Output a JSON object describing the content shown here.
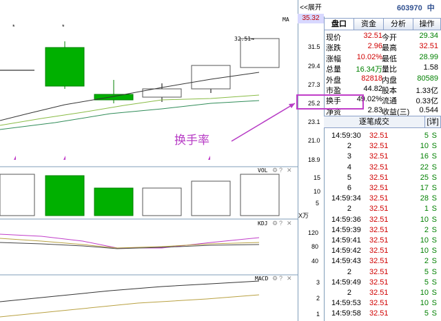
{
  "header": {
    "expand_label": "<<展开",
    "top_price": "35.32",
    "stock_code": "603970",
    "stock_name": "中农"
  },
  "tabs": [
    {
      "label": "盘口",
      "active": true
    },
    {
      "label": "资金",
      "active": false
    },
    {
      "label": "分析",
      "active": false
    },
    {
      "label": "操作",
      "active": false
    }
  ],
  "quote": {
    "rows": [
      {
        "l_label": "现价",
        "l_value": "32.51",
        "l_color": "red",
        "r_label": "今开",
        "r_value": "29.34",
        "r_color": "green"
      },
      {
        "l_label": "涨跌",
        "l_value": "2.96",
        "l_color": "red",
        "r_label": "最高",
        "r_value": "32.51",
        "r_color": "red"
      },
      {
        "l_label": "涨幅",
        "l_value": "10.02%",
        "l_color": "red",
        "r_label": "最低",
        "r_value": "28.99",
        "r_color": "green"
      },
      {
        "l_label": "总量",
        "l_value": "16.34万",
        "l_color": "green",
        "r_label": "量比",
        "r_value": "1.58",
        "r_color": "blk"
      },
      {
        "l_label": "外盘",
        "l_value": "82818",
        "l_color": "red",
        "r_label": "内盘",
        "r_value": "80589",
        "r_color": "green"
      },
      {
        "l_label": "市盈",
        "l_value": "44.82",
        "l_color": "blk",
        "r_label": "股本",
        "r_value": "1.33亿",
        "r_color": "blk"
      },
      {
        "l_label": "换手",
        "l_value": "49.02%",
        "l_color": "blk",
        "r_label": "流通",
        "r_value": "0.33亿",
        "r_color": "blk"
      },
      {
        "l_label": "净资",
        "l_value": "2.83",
        "l_color": "blk",
        "r_label": "收益(三)",
        "r_value": "0.544",
        "r_color": "blk"
      }
    ]
  },
  "trades_section": {
    "title": "逐笔成交",
    "detail_label": "[详]",
    "rows": [
      {
        "time": "14:59:30",
        "price": "32.51",
        "vol": "5",
        "side": "S"
      },
      {
        "time": "2",
        "price": "32.51",
        "vol": "10",
        "side": "S"
      },
      {
        "time": "3",
        "price": "32.51",
        "vol": "16",
        "side": "S"
      },
      {
        "time": "4",
        "price": "32.51",
        "vol": "22",
        "side": "S"
      },
      {
        "time": "5",
        "price": "32.51",
        "vol": "25",
        "side": "S"
      },
      {
        "time": "6",
        "price": "32.51",
        "vol": "17",
        "side": "S"
      },
      {
        "time": "14:59:34",
        "price": "32.51",
        "vol": "28",
        "side": "S"
      },
      {
        "time": "2",
        "price": "32.51",
        "vol": "1",
        "side": "S"
      },
      {
        "time": "14:59:36",
        "price": "32.51",
        "vol": "10",
        "side": "S"
      },
      {
        "time": "14:59:39",
        "price": "32.51",
        "vol": "2",
        "side": "S"
      },
      {
        "time": "14:59:41",
        "price": "32.51",
        "vol": "10",
        "side": "S"
      },
      {
        "time": "14:59:42",
        "price": "32.51",
        "vol": "10",
        "side": "S"
      },
      {
        "time": "14:59:43",
        "price": "32.51",
        "vol": "2",
        "side": "S"
      },
      {
        "time": "2",
        "price": "32.51",
        "vol": "5",
        "side": "S"
      },
      {
        "time": "14:59:49",
        "price": "32.51",
        "vol": "5",
        "side": "S"
      },
      {
        "time": "2",
        "price": "32.51",
        "vol": "10",
        "side": "S"
      },
      {
        "time": "14:59:53",
        "price": "32.51",
        "vol": "10",
        "side": "S"
      },
      {
        "time": "14:59:58",
        "price": "32.51",
        "vol": "5",
        "side": "S"
      }
    ]
  },
  "annotation": "换手率",
  "chart": {
    "ma_label": "MA",
    "price_label": "32.51→",
    "price_axis": [
      "31.5",
      "29.4",
      "27.3",
      "25.2",
      "23.1",
      "21.0",
      "18.9"
    ],
    "vol_label": "VOL",
    "vol_axis": [
      "15",
      "10",
      "5"
    ],
    "vol_unit": "X万",
    "kdj_label": "KDJ",
    "kdj_axis": [
      "120",
      "80",
      "40"
    ],
    "macd_label": "MACD",
    "macd_axis": [
      "3",
      "2",
      "1"
    ],
    "star": "*"
  },
  "colors": {
    "up": "#d00000",
    "down": "#00b000",
    "annotation": "#b73cc5",
    "highlight": "#c03cc8"
  }
}
